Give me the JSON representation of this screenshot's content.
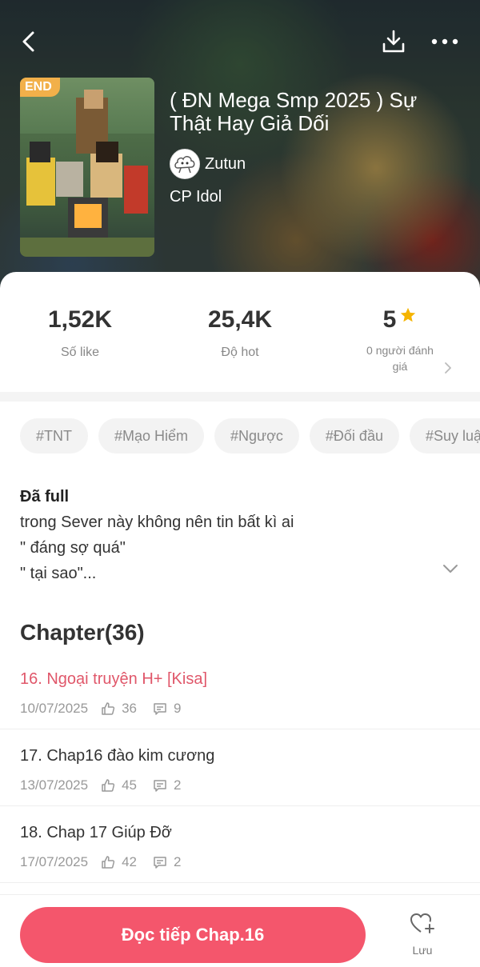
{
  "cover": {
    "badge": "END"
  },
  "story": {
    "title": "( ĐN Mega Smp 2025 ) Sự Thật Hay Giả Dối",
    "author": "Zutun",
    "genre": "CP Idol"
  },
  "stats": {
    "likes": {
      "value": "1,52K",
      "label": "Số like"
    },
    "hot": {
      "value": "25,4K",
      "label": "Độ hot"
    },
    "rating": {
      "value": "5",
      "label": "0 người đánh giá"
    }
  },
  "tags": [
    "#TNT",
    "#Mạo Hiểm",
    "#Ngược",
    "#Đối đầu",
    "#Suy luậ"
  ],
  "description": {
    "status": "Đã full",
    "lines": [
      "trong Sever này không nên tin bất kì ai",
      "\" đáng sợ quá\"",
      "\" tại sao\"..."
    ]
  },
  "chapters_header": "Chapter(36)",
  "chapters": [
    {
      "title": "16. Ngoại truyện H+ [Kisa]",
      "date": "10/07/2025",
      "likes": "36",
      "comments": "9",
      "current": true
    },
    {
      "title": "17. Chap16 đào kim cương",
      "date": "13/07/2025",
      "likes": "45",
      "comments": "2",
      "current": false
    },
    {
      "title": "18. Chap 17 Giúp Đỡ",
      "date": "17/07/2025",
      "likes": "42",
      "comments": "2",
      "current": false
    }
  ],
  "bottom": {
    "read_label": "Đọc tiếp Chap.16",
    "save_label": "Lưu"
  },
  "colors": {
    "accent": "#f4566c",
    "current_chapter": "#e0576a",
    "star": "#f5b400",
    "badge": "#f2b04a"
  }
}
